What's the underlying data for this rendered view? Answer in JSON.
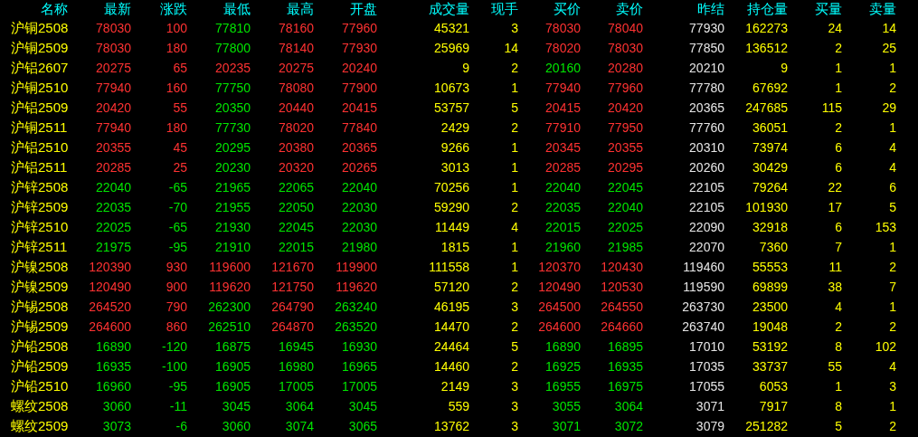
{
  "columns": [
    {
      "label": "名称",
      "kind": "name"
    },
    {
      "label": "最新",
      "kind": "price"
    },
    {
      "label": "涨跌",
      "kind": "price"
    },
    {
      "label": "最低",
      "kind": "price"
    },
    {
      "label": "最高",
      "kind": "price"
    },
    {
      "label": "开盘",
      "kind": "price"
    },
    {
      "label": "成交量",
      "kind": "volume"
    },
    {
      "label": "现手",
      "kind": "volume"
    },
    {
      "label": "买价",
      "kind": "price"
    },
    {
      "label": "卖价",
      "kind": "price"
    },
    {
      "label": "昨结",
      "kind": "settle"
    },
    {
      "label": "持仓量",
      "kind": "volume"
    },
    {
      "label": "买量",
      "kind": "volume"
    },
    {
      "label": "卖量",
      "kind": "volume"
    }
  ],
  "rows": [
    {
      "cells": [
        "沪铜2508",
        {
          "text": "78030",
          "color": "#ff3232"
        },
        {
          "text": "100",
          "color": "#ff3232"
        },
        {
          "text": "77810",
          "color": "#00e600"
        },
        {
          "text": "78160",
          "color": "#ff3232"
        },
        {
          "text": "77960",
          "color": "#ff3232"
        },
        "45321",
        "3",
        {
          "text": "78030",
          "color": "#ff3232"
        },
        {
          "text": "78040",
          "color": "#ff3232"
        },
        "77930",
        "162273",
        "24",
        "14"
      ]
    },
    {
      "cells": [
        "沪铜2509",
        {
          "text": "78030",
          "color": "#ff3232"
        },
        {
          "text": "180",
          "color": "#ff3232"
        },
        {
          "text": "77800",
          "color": "#00e600"
        },
        {
          "text": "78140",
          "color": "#ff3232"
        },
        {
          "text": "77930",
          "color": "#ff3232"
        },
        "25969",
        "14",
        {
          "text": "78020",
          "color": "#ff3232"
        },
        {
          "text": "78030",
          "color": "#ff3232"
        },
        "77850",
        "136512",
        "2",
        "25"
      ]
    },
    {
      "cells": [
        "沪铝2607",
        {
          "text": "20275",
          "color": "#ff3232"
        },
        {
          "text": "65",
          "color": "#ff3232"
        },
        {
          "text": "20235",
          "color": "#ff3232"
        },
        {
          "text": "20275",
          "color": "#ff3232"
        },
        {
          "text": "20240",
          "color": "#ff3232"
        },
        "9",
        "2",
        {
          "text": "20160",
          "color": "#00e600"
        },
        {
          "text": "20280",
          "color": "#ff3232"
        },
        "20210",
        "9",
        "1",
        "1"
      ]
    },
    {
      "cells": [
        "沪铜2510",
        {
          "text": "77940",
          "color": "#ff3232"
        },
        {
          "text": "160",
          "color": "#ff3232"
        },
        {
          "text": "77750",
          "color": "#00e600"
        },
        {
          "text": "78080",
          "color": "#ff3232"
        },
        {
          "text": "77900",
          "color": "#ff3232"
        },
        "10673",
        "1",
        {
          "text": "77940",
          "color": "#ff3232"
        },
        {
          "text": "77960",
          "color": "#ff3232"
        },
        "77780",
        "67692",
        "1",
        "2"
      ]
    },
    {
      "cells": [
        "沪铝2509",
        {
          "text": "20420",
          "color": "#ff3232"
        },
        {
          "text": "55",
          "color": "#ff3232"
        },
        {
          "text": "20350",
          "color": "#00e600"
        },
        {
          "text": "20440",
          "color": "#ff3232"
        },
        {
          "text": "20415",
          "color": "#ff3232"
        },
        "53757",
        "5",
        {
          "text": "20415",
          "color": "#ff3232"
        },
        {
          "text": "20420",
          "color": "#ff3232"
        },
        "20365",
        "247685",
        "115",
        "29"
      ]
    },
    {
      "cells": [
        "沪铜2511",
        {
          "text": "77940",
          "color": "#ff3232"
        },
        {
          "text": "180",
          "color": "#ff3232"
        },
        {
          "text": "77730",
          "color": "#00e600"
        },
        {
          "text": "78020",
          "color": "#ff3232"
        },
        {
          "text": "77840",
          "color": "#ff3232"
        },
        "2429",
        "2",
        {
          "text": "77910",
          "color": "#ff3232"
        },
        {
          "text": "77950",
          "color": "#ff3232"
        },
        "77760",
        "36051",
        "2",
        "1"
      ]
    },
    {
      "cells": [
        "沪铝2510",
        {
          "text": "20355",
          "color": "#ff3232"
        },
        {
          "text": "45",
          "color": "#ff3232"
        },
        {
          "text": "20295",
          "color": "#00e600"
        },
        {
          "text": "20380",
          "color": "#ff3232"
        },
        {
          "text": "20365",
          "color": "#ff3232"
        },
        "9266",
        "1",
        {
          "text": "20345",
          "color": "#ff3232"
        },
        {
          "text": "20355",
          "color": "#ff3232"
        },
        "20310",
        "73974",
        "6",
        "4"
      ]
    },
    {
      "cells": [
        "沪铝2511",
        {
          "text": "20285",
          "color": "#ff3232"
        },
        {
          "text": "25",
          "color": "#ff3232"
        },
        {
          "text": "20230",
          "color": "#00e600"
        },
        {
          "text": "20320",
          "color": "#ff3232"
        },
        {
          "text": "20265",
          "color": "#ff3232"
        },
        "3013",
        "1",
        {
          "text": "20285",
          "color": "#ff3232"
        },
        {
          "text": "20295",
          "color": "#ff3232"
        },
        "20260",
        "30429",
        "6",
        "4"
      ]
    },
    {
      "cells": [
        "沪锌2508",
        {
          "text": "22040",
          "color": "#00e600"
        },
        {
          "text": "-65",
          "color": "#00e600"
        },
        {
          "text": "21965",
          "color": "#00e600"
        },
        {
          "text": "22065",
          "color": "#00e600"
        },
        {
          "text": "22040",
          "color": "#00e600"
        },
        "70256",
        "1",
        {
          "text": "22040",
          "color": "#00e600"
        },
        {
          "text": "22045",
          "color": "#00e600"
        },
        "22105",
        "79264",
        "22",
        "6"
      ]
    },
    {
      "cells": [
        "沪锌2509",
        {
          "text": "22035",
          "color": "#00e600"
        },
        {
          "text": "-70",
          "color": "#00e600"
        },
        {
          "text": "21955",
          "color": "#00e600"
        },
        {
          "text": "22050",
          "color": "#00e600"
        },
        {
          "text": "22030",
          "color": "#00e600"
        },
        "59290",
        "2",
        {
          "text": "22035",
          "color": "#00e600"
        },
        {
          "text": "22040",
          "color": "#00e600"
        },
        "22105",
        "101930",
        "17",
        "5"
      ]
    },
    {
      "cells": [
        "沪锌2510",
        {
          "text": "22025",
          "color": "#00e600"
        },
        {
          "text": "-65",
          "color": "#00e600"
        },
        {
          "text": "21930",
          "color": "#00e600"
        },
        {
          "text": "22045",
          "color": "#00e600"
        },
        {
          "text": "22030",
          "color": "#00e600"
        },
        "11449",
        "4",
        {
          "text": "22015",
          "color": "#00e600"
        },
        {
          "text": "22025",
          "color": "#00e600"
        },
        "22090",
        "32918",
        "6",
        "153"
      ]
    },
    {
      "cells": [
        "沪锌2511",
        {
          "text": "21975",
          "color": "#00e600"
        },
        {
          "text": "-95",
          "color": "#00e600"
        },
        {
          "text": "21910",
          "color": "#00e600"
        },
        {
          "text": "22015",
          "color": "#00e600"
        },
        {
          "text": "21980",
          "color": "#00e600"
        },
        "1815",
        "1",
        {
          "text": "21960",
          "color": "#00e600"
        },
        {
          "text": "21985",
          "color": "#00e600"
        },
        "22070",
        "7360",
        "7",
        "1"
      ]
    },
    {
      "cells": [
        "沪镍2508",
        {
          "text": "120390",
          "color": "#ff3232"
        },
        {
          "text": "930",
          "color": "#ff3232"
        },
        {
          "text": "119600",
          "color": "#ff3232"
        },
        {
          "text": "121670",
          "color": "#ff3232"
        },
        {
          "text": "119900",
          "color": "#ff3232"
        },
        "111558",
        "1",
        {
          "text": "120370",
          "color": "#ff3232"
        },
        {
          "text": "120430",
          "color": "#ff3232"
        },
        "119460",
        "55553",
        "11",
        "2"
      ]
    },
    {
      "cells": [
        "沪镍2509",
        {
          "text": "120490",
          "color": "#ff3232"
        },
        {
          "text": "900",
          "color": "#ff3232"
        },
        {
          "text": "119620",
          "color": "#ff3232"
        },
        {
          "text": "121750",
          "color": "#ff3232"
        },
        {
          "text": "119620",
          "color": "#ff3232"
        },
        "57120",
        "2",
        {
          "text": "120490",
          "color": "#ff3232"
        },
        {
          "text": "120530",
          "color": "#ff3232"
        },
        "119590",
        "69899",
        "38",
        "7"
      ]
    },
    {
      "cells": [
        "沪锡2508",
        {
          "text": "264520",
          "color": "#ff3232"
        },
        {
          "text": "790",
          "color": "#ff3232"
        },
        {
          "text": "262300",
          "color": "#00e600"
        },
        {
          "text": "264790",
          "color": "#ff3232"
        },
        {
          "text": "263240",
          "color": "#00e600"
        },
        "46195",
        "3",
        {
          "text": "264500",
          "color": "#ff3232"
        },
        {
          "text": "264550",
          "color": "#ff3232"
        },
        "263730",
        "23500",
        "4",
        "1"
      ]
    },
    {
      "cells": [
        "沪锡2509",
        {
          "text": "264600",
          "color": "#ff3232"
        },
        {
          "text": "860",
          "color": "#ff3232"
        },
        {
          "text": "262510",
          "color": "#00e600"
        },
        {
          "text": "264870",
          "color": "#ff3232"
        },
        {
          "text": "263520",
          "color": "#00e600"
        },
        "14470",
        "2",
        {
          "text": "264600",
          "color": "#ff3232"
        },
        {
          "text": "264660",
          "color": "#ff3232"
        },
        "263740",
        "19048",
        "2",
        "2"
      ]
    },
    {
      "cells": [
        "沪铅2508",
        {
          "text": "16890",
          "color": "#00e600"
        },
        {
          "text": "-120",
          "color": "#00e600"
        },
        {
          "text": "16875",
          "color": "#00e600"
        },
        {
          "text": "16945",
          "color": "#00e600"
        },
        {
          "text": "16930",
          "color": "#00e600"
        },
        "24464",
        "5",
        {
          "text": "16890",
          "color": "#00e600"
        },
        {
          "text": "16895",
          "color": "#00e600"
        },
        "17010",
        "53192",
        "8",
        "102"
      ]
    },
    {
      "cells": [
        "沪铅2509",
        {
          "text": "16935",
          "color": "#00e600"
        },
        {
          "text": "-100",
          "color": "#00e600"
        },
        {
          "text": "16905",
          "color": "#00e600"
        },
        {
          "text": "16980",
          "color": "#00e600"
        },
        {
          "text": "16965",
          "color": "#00e600"
        },
        "14460",
        "2",
        {
          "text": "16925",
          "color": "#00e600"
        },
        {
          "text": "16935",
          "color": "#00e600"
        },
        "17035",
        "33737",
        "55",
        "4"
      ]
    },
    {
      "cells": [
        "沪铅2510",
        {
          "text": "16960",
          "color": "#00e600"
        },
        {
          "text": "-95",
          "color": "#00e600"
        },
        {
          "text": "16905",
          "color": "#00e600"
        },
        {
          "text": "17005",
          "color": "#00e600"
        },
        {
          "text": "17005",
          "color": "#00e600"
        },
        "2149",
        "3",
        {
          "text": "16955",
          "color": "#00e600"
        },
        {
          "text": "16975",
          "color": "#00e600"
        },
        "17055",
        "6053",
        "1",
        "3"
      ]
    },
    {
      "cells": [
        "螺纹2508",
        {
          "text": "3060",
          "color": "#00e600"
        },
        {
          "text": "-11",
          "color": "#00e600"
        },
        {
          "text": "3045",
          "color": "#00e600"
        },
        {
          "text": "3064",
          "color": "#00e600"
        },
        {
          "text": "3045",
          "color": "#00e600"
        },
        "559",
        "3",
        {
          "text": "3055",
          "color": "#00e600"
        },
        {
          "text": "3064",
          "color": "#00e600"
        },
        "3071",
        "7917",
        "8",
        "1"
      ]
    },
    {
      "cells": [
        "螺纹2509",
        {
          "text": "3073",
          "color": "#00e600"
        },
        {
          "text": "-6",
          "color": "#00e600"
        },
        {
          "text": "3060",
          "color": "#00e600"
        },
        {
          "text": "3074",
          "color": "#00e600"
        },
        {
          "text": "3065",
          "color": "#00e600"
        },
        "13762",
        "3",
        {
          "text": "3071",
          "color": "#00e600"
        },
        {
          "text": "3072",
          "color": "#00e600"
        },
        "3079",
        "251282",
        "5",
        "2"
      ]
    }
  ]
}
